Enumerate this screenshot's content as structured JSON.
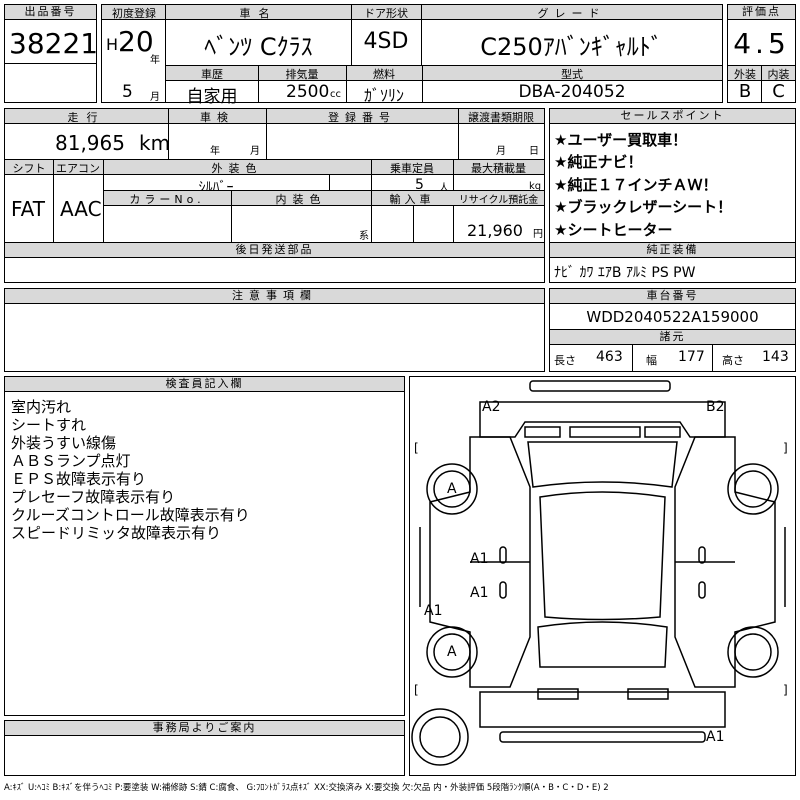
{
  "lot": {
    "label": "出品番号",
    "value": "38221"
  },
  "first_reg": {
    "label": "初度登録",
    "era": "H",
    "year": "20",
    "year_unit": "年",
    "month": "5",
    "month_unit": "月"
  },
  "car_name": {
    "label": "車名",
    "value": "ﾍﾞﾝﾂ Cｸﾗｽ"
  },
  "door": {
    "label": "ドア形状",
    "value": "4SD"
  },
  "grade": {
    "label": "グレード",
    "value": "C250ｱﾊﾞﾝｷﾞｬﾙﾄﾞ"
  },
  "score": {
    "label": "評価点",
    "value": "4.5",
    "ext_label": "外装",
    "int_label": "内装",
    "ext": "B",
    "int": "C"
  },
  "history": {
    "label": "車歴",
    "value": "自家用"
  },
  "displacement": {
    "label": "排気量",
    "value": "2500",
    "unit": "cc"
  },
  "fuel": {
    "label": "燃料",
    "value": "ｶﾞｿﾘﾝ"
  },
  "model": {
    "label": "型式",
    "value": "DBA-204052"
  },
  "mileage": {
    "label": "走行",
    "value": "81,965",
    "unit": "km"
  },
  "inspection": {
    "label": "車検",
    "year_unit": "年",
    "month_unit": "月"
  },
  "reg_no": {
    "label": "登録番号"
  },
  "transfer": {
    "label": "譲渡書類期限",
    "month_unit": "月",
    "day_unit": "日"
  },
  "shift": {
    "label": "シフト",
    "value": "FAT"
  },
  "ac": {
    "label": "エアコン",
    "value": "AAC"
  },
  "ext_color": {
    "label": "外装色",
    "value": "ｼﾙﾊﾞｰ"
  },
  "capacity": {
    "label": "乗車定員",
    "value": "5",
    "unit": "人"
  },
  "max_load": {
    "label": "最大積載量",
    "unit": "kg"
  },
  "color_no": {
    "label": "カラーNo."
  },
  "int_color": {
    "label": "内装色",
    "unit": "系"
  },
  "import": {
    "label": "輸入車"
  },
  "recycle": {
    "label": "リサイクル預託金",
    "value": "21,960",
    "unit": "円"
  },
  "later_parts": {
    "label": "後日発送部品"
  },
  "sales_points": {
    "label": "セールスポイント",
    "items": [
      "★ユーザー買取車！",
      "★純正ナビ！",
      "★純正１７インチＡＷ！",
      "★ブラックレザーシート！",
      "★シートヒーター"
    ]
  },
  "equipment": {
    "label": "純正装備",
    "value": "ﾅﾋﾞ ｶﾜ ｴｱB ｱﾙﾐ PS PW"
  },
  "notes": {
    "label": "注意事項欄"
  },
  "chassis": {
    "label": "車台番号",
    "value": "WDD2040522A159000"
  },
  "dims": {
    "label": "諸元",
    "len_label": "長さ",
    "len": "463",
    "wid_label": "幅",
    "wid": "177",
    "hgt_label": "高さ",
    "hgt": "143"
  },
  "inspector": {
    "label": "検査員記入欄",
    "lines": [
      "室内汚れ",
      "シートすれ",
      "外装うすい線傷",
      "ＡＢＳランプ点灯",
      "ＥＰＳ故障表示有り",
      "プレセーフ故障表示有り",
      "クルーズコントロール故障表示有り",
      "スピードリミッタ故障表示有り"
    ]
  },
  "office": {
    "label": "事務局よりご案内"
  },
  "diagram": {
    "marks": [
      "A2",
      "B2",
      "A",
      "A1",
      "A1",
      "A1",
      "A",
      "A1"
    ],
    "bracket_l": "[",
    "bracket_r": "]"
  },
  "legend": "A:ｷｽﾞ U:ﾍｺﾐ B:ｷｽﾞを伴うﾍｺﾐ P:要塗装 W:補修跡 S:錆 C:腐食、 G:ﾌﾛﾝﾄｶﾞﾗｽ点ｷｽﾞ XX:交換済み X:要交換 欠:欠品 内・外装評価 5段階ﾗﾝｸ順(A・B・C・D・E) 2"
}
